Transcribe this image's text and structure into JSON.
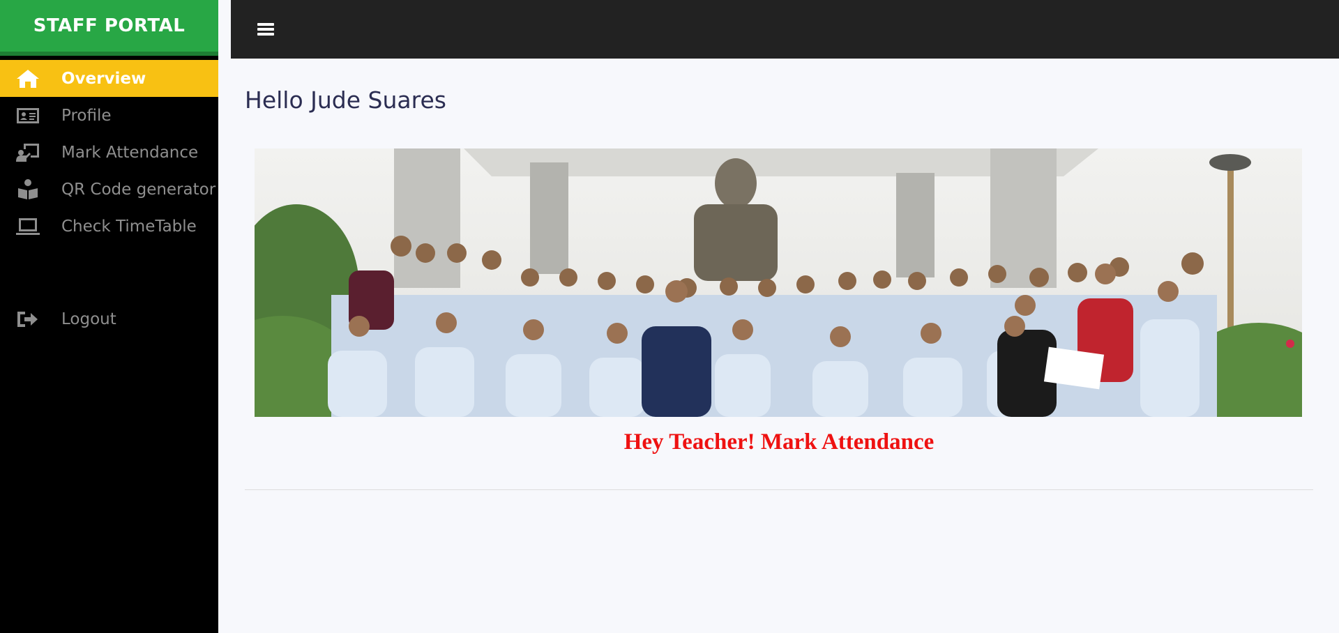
{
  "brand": {
    "title": "STAFF PORTAL"
  },
  "sidebar": {
    "items": [
      {
        "label": "Overview",
        "icon": "home-icon",
        "active": true
      },
      {
        "label": "Profile",
        "icon": "id-card-icon"
      },
      {
        "label": "Mark Attendance",
        "icon": "chalkboard-teacher-icon"
      },
      {
        "label": "QR Code generator",
        "icon": "reading-person-icon"
      },
      {
        "label": "Check TimeTable",
        "icon": "laptop-icon"
      }
    ],
    "logout": {
      "label": "Logout",
      "icon": "sign-out-icon"
    }
  },
  "topbar": {
    "menu_icon": "hamburger-menu-icon"
  },
  "main": {
    "greeting": "Hello Jude Suares",
    "banner": {
      "description_icon": "group-photo-image"
    },
    "cta": "Hey Teacher! Mark Attendance"
  },
  "colors": {
    "brand_bg": "#28a745",
    "active_bg": "#f8c113",
    "sidebar_bg": "#000000",
    "topbar_bg": "#222222",
    "cta_text": "#ee1111",
    "greeting_text": "#2b2d52"
  }
}
